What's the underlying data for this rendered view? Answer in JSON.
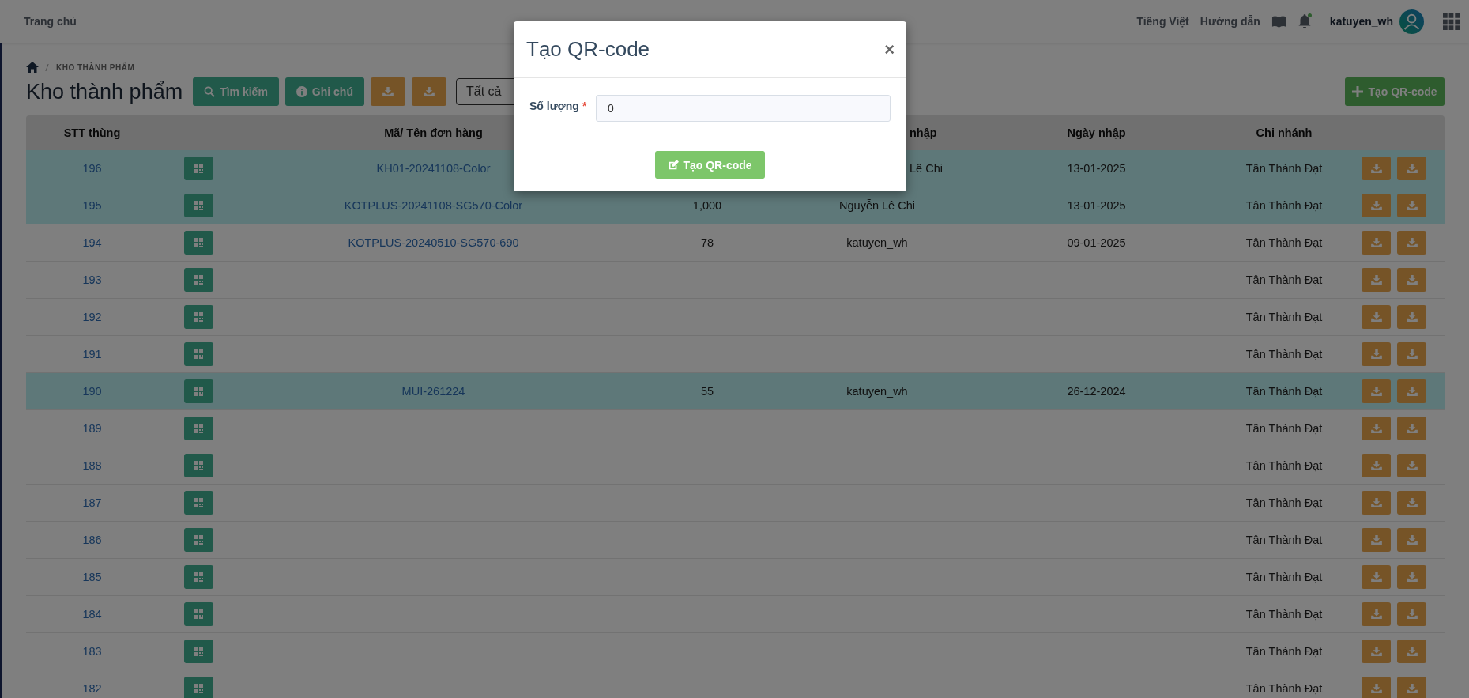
{
  "topbar": {
    "home_link": "Trang chủ",
    "language": "Tiếng Việt",
    "guide": "Hướng dẫn",
    "username": "katuyen_wh"
  },
  "breadcrumb": "KHO THÀNH PHẨM",
  "page_title": "Kho thành phẩm",
  "toolbar": {
    "search_button": "Tìm kiếm",
    "note_button": "Ghi chú",
    "filter": "Tất cả",
    "create_button": "Tạo QR-code"
  },
  "table": {
    "columns": [
      {
        "label": "STT thùng",
        "partial": false
      },
      {
        "label": "Mã/ Tên đơn hàng",
        "partial": false
      },
      {
        "label": "nhập",
        "partial": true
      },
      {
        "label": "Ngày nhập",
        "partial": false
      },
      {
        "label": "Chi nhánh",
        "partial": false
      }
    ],
    "rows": [
      {
        "no": "196",
        "order": "KH01-20241108-Color",
        "importer": "Lê Chi",
        "importer_partial": true,
        "date": "13-01-2025",
        "branch": "Tân Thành Đạt",
        "highlighted": true
      },
      {
        "no": "195",
        "order": "KOTPLUS-20241108-SG570-Color",
        "quantity": "1,000",
        "importer": "Nguyễn Lê Chi",
        "importer_partial": false,
        "date": "13-01-2025",
        "branch": "Tân Thành Đạt",
        "highlighted": true
      },
      {
        "no": "194",
        "order": "KOTPLUS-20240510-SG570-690",
        "quantity": "78",
        "importer": "katuyen_wh",
        "importer_partial": false,
        "date": "09-01-2025",
        "branch": "Tân Thành Đạt",
        "highlighted": false
      },
      {
        "no": "193",
        "branch": "Tân Thành Đạt",
        "highlighted": false
      },
      {
        "no": "192",
        "branch": "Tân Thành Đạt",
        "highlighted": false
      },
      {
        "no": "191",
        "branch": "Tân Thành Đạt",
        "highlighted": false
      },
      {
        "no": "190",
        "order": "MUI-261224",
        "quantity": "55",
        "importer": "katuyen_wh",
        "importer_partial": false,
        "date": "26-12-2024",
        "branch": "Tân Thành Đạt",
        "highlighted": true
      },
      {
        "no": "189",
        "branch": "Tân Thành Đạt",
        "highlighted": false
      },
      {
        "no": "188",
        "branch": "Tân Thành Đạt",
        "highlighted": false
      },
      {
        "no": "187",
        "branch": "Tân Thành Đạt",
        "highlighted": false
      },
      {
        "no": "186",
        "branch": "Tân Thành Đạt",
        "highlighted": false
      },
      {
        "no": "185",
        "branch": "Tân Thành Đạt",
        "highlighted": false
      },
      {
        "no": "184",
        "branch": "Tân Thành Đạt",
        "highlighted": false
      },
      {
        "no": "183",
        "branch": "Tân Thành Đạt",
        "highlighted": false
      },
      {
        "no": "182",
        "branch": "Tân Thành Đạt",
        "highlighted": false
      }
    ]
  },
  "modal": {
    "title": "Tạo QR-code",
    "close": "×",
    "fields": [
      {
        "label": "Số lượng",
        "required_mark": "*",
        "value": "0"
      }
    ],
    "submit": "Tạo QR-code"
  }
}
